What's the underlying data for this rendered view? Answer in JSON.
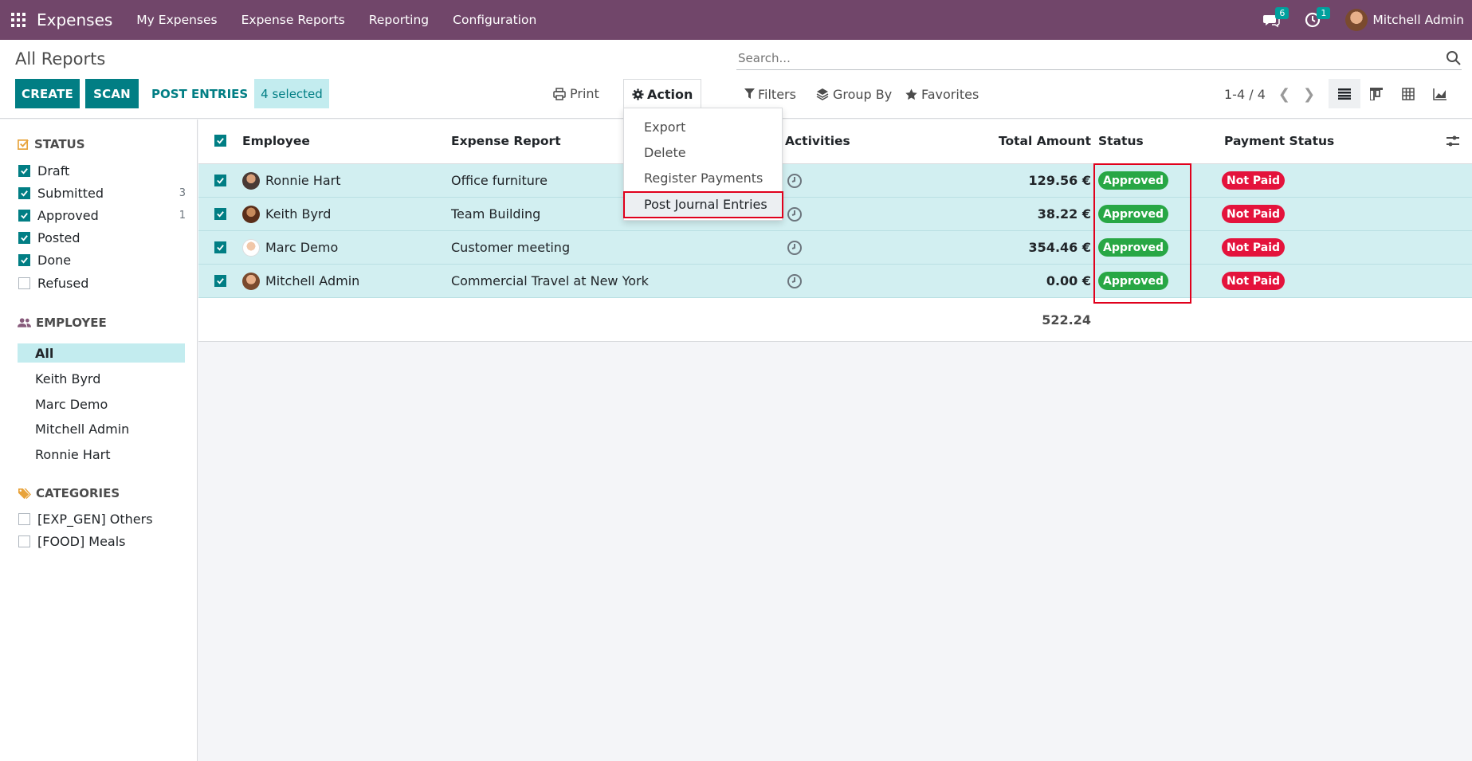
{
  "navbar": {
    "app_name": "Expenses",
    "menu": [
      "My Expenses",
      "Expense Reports",
      "Reporting",
      "Configuration"
    ],
    "messages_count": "6",
    "activities_count": "1",
    "user_name": "Mitchell Admin"
  },
  "control": {
    "title": "All Reports",
    "create_label": "CREATE",
    "scan_label": "SCAN",
    "post_entries_label": "POST ENTRIES",
    "selected_label": "4 selected",
    "print_label": "Print",
    "action_label": "Action",
    "search_placeholder": "Search...",
    "filters_label": "Filters",
    "group_by_label": "Group By",
    "favorites_label": "Favorites",
    "pager": "1-4 / 4"
  },
  "action_menu": {
    "items": [
      "Export",
      "Delete",
      "Register Payments",
      "Post Journal Entries"
    ]
  },
  "sidebar": {
    "status_title": "STATUS",
    "status_items": [
      {
        "label": "Draft",
        "count": ""
      },
      {
        "label": "Submitted",
        "count": "3"
      },
      {
        "label": "Approved",
        "count": "1"
      },
      {
        "label": "Posted",
        "count": ""
      },
      {
        "label": "Done",
        "count": ""
      },
      {
        "label": "Refused",
        "count": ""
      }
    ],
    "employee_title": "EMPLOYEE",
    "employee_items": [
      "All",
      "Keith Byrd",
      "Marc Demo",
      "Mitchell Admin",
      "Ronnie Hart"
    ],
    "categories_title": "CATEGORIES",
    "category_items": [
      "[EXP_GEN] Others",
      "[FOOD] Meals"
    ]
  },
  "list": {
    "headers": {
      "employee": "Employee",
      "report": "Expense Report",
      "activities": "Activities",
      "total": "Total Amount",
      "status": "Status",
      "payment": "Payment Status"
    },
    "rows": [
      {
        "employee": "Ronnie Hart",
        "report": "Office furniture",
        "amount": "129.56 €",
        "status": "Approved",
        "payment": "Not Paid"
      },
      {
        "employee": "Keith Byrd",
        "report": "Team Building",
        "amount": "38.22 €",
        "status": "Approved",
        "payment": "Not Paid"
      },
      {
        "employee": "Marc Demo",
        "report": "Customer meeting",
        "amount": "354.46 €",
        "status": "Approved",
        "payment": "Not Paid"
      },
      {
        "employee": "Mitchell Admin",
        "report": "Commercial Travel at New York",
        "amount": "0.00 €",
        "status": "Approved",
        "payment": "Not Paid"
      }
    ],
    "total": "522.24"
  },
  "colors": {
    "navbar": "#71466a",
    "primary": "#017e84",
    "approved": "#28a745",
    "not_paid": "#e4133c",
    "annotation": "#e0001c"
  }
}
